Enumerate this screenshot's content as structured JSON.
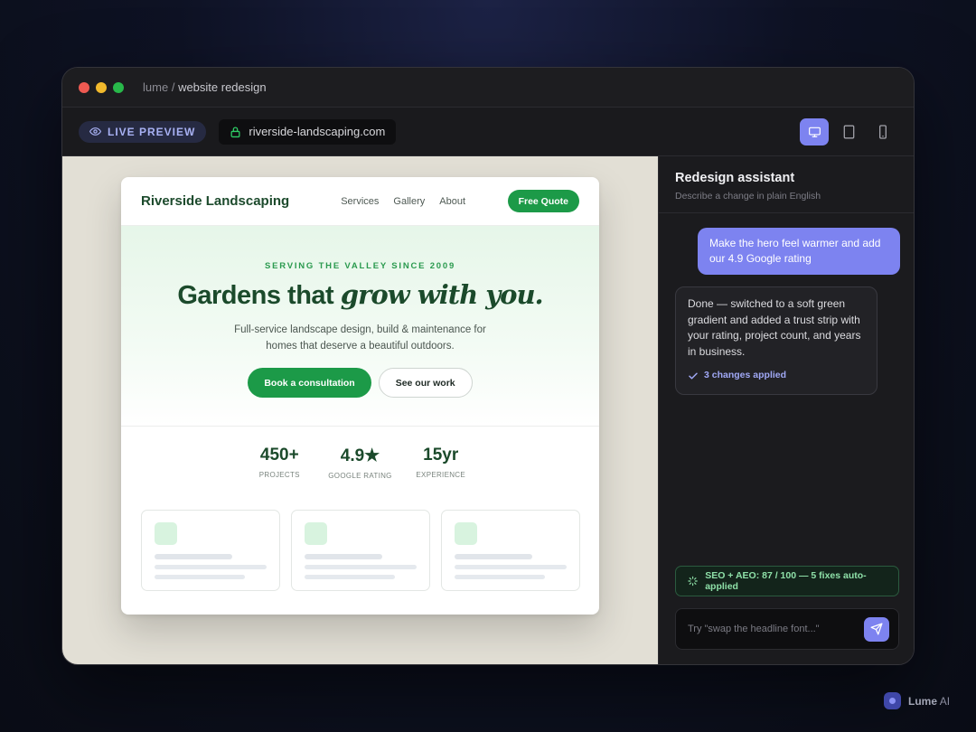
{
  "window": {
    "breadcrumb_project": "lume",
    "breadcrumb_separator": "/",
    "breadcrumb_page": "website redesign"
  },
  "toolbar": {
    "live_preview_label": "LIVE PREVIEW",
    "url": "riverside-landscaping.com",
    "devices": [
      "desktop-icon",
      "tablet-icon",
      "mobile-icon"
    ],
    "active_device": "desktop"
  },
  "site": {
    "brand": "Riverside Landscaping",
    "nav_links": [
      "Services",
      "Gallery",
      "About"
    ],
    "cta": "Free Quote",
    "hero": {
      "eyebrow": "SERVING THE VALLEY SINCE 2009",
      "headline_plain": "Gardens that",
      "headline_italic": "grow with you.",
      "subtext": "Full-service landscape design, build & maintenance for homes that deserve a beautiful outdoors.",
      "primary_button": "Book a consultation",
      "secondary_button": "See our work"
    },
    "stats": [
      {
        "value": "450+",
        "label": "PROJECTS"
      },
      {
        "value": "4.9★",
        "label": "GOOGLE RATING"
      },
      {
        "value": "15yr",
        "label": "EXPERIENCE"
      }
    ]
  },
  "assistant": {
    "title": "Redesign assistant",
    "subtitle": "Describe a change in plain English",
    "user_message": "Make the hero feel warmer and add our 4.9 Google rating",
    "bot_message": "Done — switched to a soft green gradient and added a trust strip with your rating, project count, and years in business.",
    "changes_applied": "3 changes applied",
    "seo_status": "SEO + AEO: 87 / 100 — 5 fixes auto-applied",
    "input_placeholder": "Try \"swap the headline font...\""
  },
  "footer": {
    "brand_bold": "Lume",
    "brand_rest": " AI"
  },
  "colors": {
    "accent": "#7d83f0",
    "site_green": "#1c9a48",
    "site_dark_green": "#1b4a2b",
    "seo_green": "#8ee0a8"
  }
}
